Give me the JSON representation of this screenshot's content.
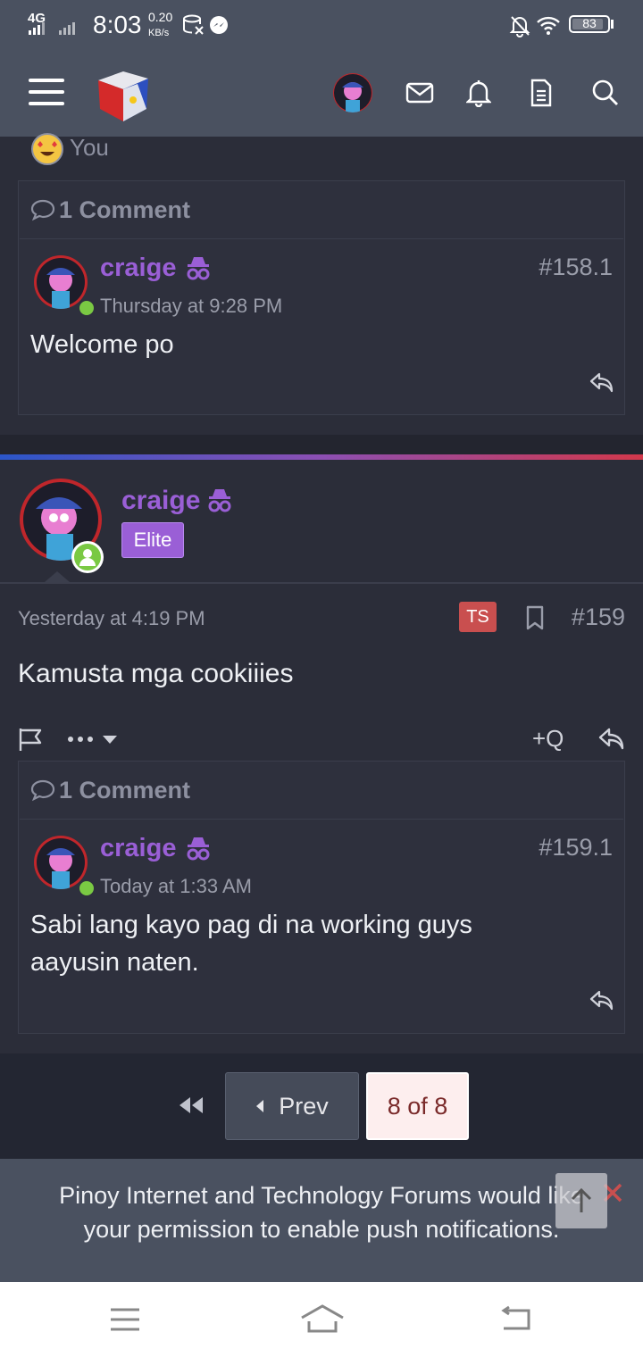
{
  "status_bar": {
    "network": "4G",
    "time": "8:03",
    "speed_value": "0.20",
    "speed_unit": "KB/s",
    "battery": "83"
  },
  "reaction": {
    "label": "You"
  },
  "post158": {
    "comments_label": "1 Comment",
    "comment": {
      "user": "craige",
      "post_no": "#158.1",
      "time": "Thursday at 9:28 PM",
      "text": "Welcome po"
    }
  },
  "post159": {
    "user": "craige",
    "badge": "Elite",
    "time": "Yesterday at 4:19 PM",
    "ts_label": "TS",
    "post_no": "#159",
    "text": "Kamusta mga cookiiies",
    "quote_label": "+Q",
    "comments_label": "1 Comment",
    "comment": {
      "user": "craige",
      "post_no": "#159.1",
      "time": "Today at 1:33 AM",
      "text_line1": "Sabi lang kayo pag di na working guys",
      "text_line2": "aayusin naten."
    }
  },
  "pagination": {
    "prev_label": "Prev",
    "page_label": "8 of 8"
  },
  "notification": {
    "line1": "Pinoy Internet and Technology Forums would like",
    "line2": "your permission to enable push notifications."
  },
  "colors": {
    "accent_purple": "#9a5fd6",
    "online_green": "#7ac943",
    "ts_red": "#c94f4f"
  }
}
